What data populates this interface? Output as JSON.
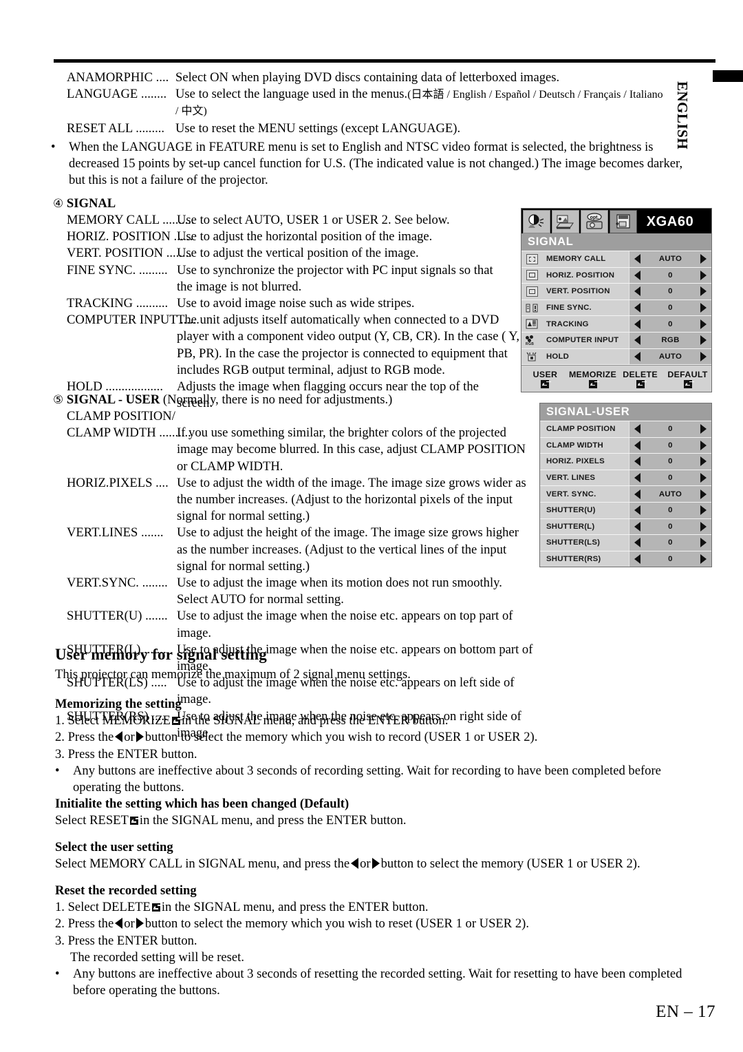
{
  "page": {
    "side_tab": "ENGLISH",
    "page_number": "EN – 17"
  },
  "feature_defs": [
    {
      "term": "ANAMORPHIC ....",
      "desc": "Select ON when playing DVD discs containing data of letterboxed images."
    },
    {
      "term": "LANGUAGE ........",
      "desc": "Use to select the language used in the menus.",
      "desc_small": "(日本語 / English / Español / Deutsch / Français / Italiano",
      "cont": "/ 中文)"
    },
    {
      "term": "RESET ALL .........",
      "desc": "Use to reset the MENU settings (except LANGUAGE)."
    }
  ],
  "feature_note": {
    "bullet": "•",
    "line1": "When the LANGUAGE in FEATURE menu is set to English and NTSC video format is selected, the brightness is",
    "line2": "decreased 15 points by set-up cancel function for U.S. (The indicated value is not changed.) The image becomes darker,",
    "line3": "but this is not a failure of the projector."
  },
  "signal_section": {
    "marker": "④",
    "heading": "SIGNAL",
    "items": [
      {
        "term": "MEMORY CALL ..........",
        "lines": [
          "Use to select AUTO, USER 1 or USER 2. See below."
        ]
      },
      {
        "term": "HORIZ. POSITION ......",
        "lines": [
          "Use to adjust the horizontal position of the image."
        ]
      },
      {
        "term": "VERT. POSITION ........",
        "lines": [
          "Use to adjust the vertical position of the image."
        ]
      },
      {
        "term": "FINE SYNC. .........",
        "lines": [
          "Use to synchronize the projector with PC input signals so that",
          "the image is not blurred."
        ]
      },
      {
        "term": "TRACKING ..........",
        "lines": [
          "Use to avoid image noise such as wide stripes."
        ]
      },
      {
        "term": "COMPUTER INPUT ......",
        "lines": [
          "The unit adjusts itself automatically when connected to a DVD",
          "player with a component video output (Y, CB, CR). In the case ( Y,",
          "PB, PR). In the case the projector is connected to equipment that",
          "includes RGB output terminal, adjust to RGB mode."
        ]
      },
      {
        "term": "HOLD ..................",
        "lines": [
          "Adjusts the image when flagging occurs near the top of the",
          "screen."
        ]
      }
    ]
  },
  "signal_user_section": {
    "marker": "⑤",
    "heading": "SIGNAL  - USER",
    "heading_note": "(Normally, there is no need for adjustments.)",
    "subterm": "CLAMP POSITION/",
    "items": [
      {
        "term": "CLAMP WIDTH ..........",
        "lines": [
          "If you use something similar, the brighter colors of the projected",
          "image may become blurred. In this case, adjust CLAMP POSITION",
          "or CLAMP WIDTH."
        ]
      },
      {
        "term": "HORIZ.PIXELS ....",
        "lines": [
          "Use to adjust the width of the image.  The image size grows wider as",
          "the number increases.  (Adjust to the horizontal pixels of the input",
          "signal for normal setting.)"
        ]
      },
      {
        "term": "VERT.LINES .......",
        "lines": [
          "Use to adjust the height of the image.  The image size grows higher",
          "as the number increases.  (Adjust to the vertical lines of the input",
          "signal for normal setting.)"
        ]
      },
      {
        "term": "VERT.SYNC. ........",
        "lines": [
          "Use to adjust the image when its motion does not run smoothly.",
          "Select AUTO for normal setting."
        ]
      },
      {
        "term": "SHUTTER(U) .......",
        "lines": [
          "Use to adjust the image when the noise etc. appears on top part of image."
        ]
      },
      {
        "term": "SHUTTER(L) .......",
        "lines": [
          "Use to adjust the image when the noise etc. appears on bottom part of image."
        ]
      },
      {
        "term": "SHUTTER(LS) .....",
        "lines": [
          "Use to adjust the image when the noise etc. appears on left side of image."
        ]
      },
      {
        "term": "SHUTTER(RS) .....",
        "lines": [
          "Use to adjust the image when the noise etc. appears on right side of image."
        ]
      }
    ]
  },
  "user_memory": {
    "title": "User memory for signal setting",
    "intro": "This projector can memorize the maximum of 2 signal menu settings.",
    "memorizing": {
      "heading": "Memorizing the setting",
      "step1_a": "1. Select MEMORIZE",
      "step1_b": "in the SIGNAL menu, and press the ENTER button.",
      "step2_a": "2. Press the",
      "step2_b": "or",
      "step2_c": "button to select the memory which you wish to record (USER 1 or USER 2).",
      "step3": "3. Press the ENTER button.",
      "bullet": "•",
      "note1": "Any buttons are ineffective about 3 seconds of recording setting.  Wait for recording to have been completed before",
      "note2": "operating the buttons."
    },
    "initialize": {
      "heading": "Initialite the setting which has been changed (Default)",
      "line_a": "Select RESET",
      "line_b": "in the SIGNAL menu, and press the ENTER button."
    },
    "select_user": {
      "heading": "Select the user setting",
      "line_a": "Select MEMORY CALL in SIGNAL menu, and press the",
      "line_b": "or",
      "line_c": "button to select the memory (USER 1 or USER 2)."
    },
    "reset_recorded": {
      "heading": "Reset the recorded setting",
      "step1_a": "1. Select DELETE",
      "step1_b": "in the SIGNAL menu, and press the ENTER button.",
      "step2_a": "2. Press the",
      "step2_b": "or",
      "step2_c": "button to select the memory which you wish to reset (USER 1 or USER 2).",
      "step3": "3. Press the ENTER button.",
      "step3_sub": "The recorded setting will be reset.",
      "bullet": "•",
      "note1": "Any buttons are ineffective about 3 seconds of resetting the recorded setting.  Wait for resetting to have been completed",
      "note2": "before operating the buttons."
    }
  },
  "osd_signal": {
    "signal_label": "XGA60",
    "menu_title": "SIGNAL",
    "tabs": [
      {
        "icon": "image-adjust-icon",
        "selected": false
      },
      {
        "icon": "video-icon",
        "selected": false
      },
      {
        "icon": "option-icon",
        "selected": false
      },
      {
        "icon": "signal-icon",
        "selected": true
      }
    ],
    "rows": [
      {
        "icon": "memory-call-icon",
        "label": "MEMORY CALL",
        "value": "AUTO"
      },
      {
        "icon": "horiz-position-icon",
        "label": "HORIZ. POSITION",
        "value": "0"
      },
      {
        "icon": "vert-position-icon",
        "label": "VERT. POSITION",
        "value": "0"
      },
      {
        "icon": "fine-sync-icon",
        "label": "FINE SYNC.",
        "value": "0"
      },
      {
        "icon": "tracking-icon",
        "label": "TRACKING",
        "value": "0"
      },
      {
        "icon": "computer-input-icon",
        "label": "COMPUTER INPUT",
        "value": "RGB"
      },
      {
        "icon": "hold-icon",
        "label": "HOLD",
        "value": "AUTO"
      }
    ],
    "buttons": [
      {
        "label": "USER"
      },
      {
        "label": "MEMORIZE"
      },
      {
        "label": "DELETE"
      },
      {
        "label": "DEFAULT"
      }
    ]
  },
  "osd_signal_user": {
    "menu_title": "SIGNAL-USER",
    "rows": [
      {
        "label": "CLAMP POSITION",
        "value": "0"
      },
      {
        "label": "CLAMP WIDTH",
        "value": "0"
      },
      {
        "label": "HORIZ. PIXELS",
        "value": "0"
      },
      {
        "label": "VERT. LINES",
        "value": "0"
      },
      {
        "label": "VERT. SYNC.",
        "value": "AUTO"
      },
      {
        "label": "SHUTTER(U)",
        "value": "0"
      },
      {
        "label": "SHUTTER(L)",
        "value": "0"
      },
      {
        "label": "SHUTTER(LS)",
        "value": "0"
      },
      {
        "label": "SHUTTER(RS)",
        "value": "0"
      }
    ]
  },
  "colors": {
    "osd_body": "#d2d2d2",
    "osd_value": "#b5b5b5",
    "osd_band": "#9e9e9e",
    "osd_header": "#000000"
  }
}
